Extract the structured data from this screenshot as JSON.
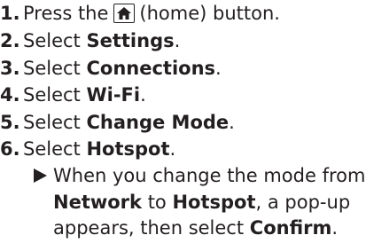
{
  "steps": [
    {
      "number": "1.",
      "before": "Press the",
      "icon": "home-icon",
      "after": "(home) button."
    },
    {
      "number": "2.",
      "text": "Select",
      "keyword": "Settings",
      "end": "."
    },
    {
      "number": "3.",
      "text": "Select",
      "keyword": "Connections",
      "end": "."
    },
    {
      "number": "4.",
      "text": "Select",
      "keyword": "Wi-Fi",
      "end": "."
    },
    {
      "number": "5.",
      "text": "Select",
      "keyword": "Change Mode",
      "end": "."
    },
    {
      "number": "6.",
      "text": "Select",
      "keyword": "Hotspot",
      "end": "."
    }
  ],
  "note": {
    "line1": "When you change the mode from",
    "line2_kw1": "Network",
    "line2_mid": "to",
    "line2_kw2": "Hotspot",
    "line2_end": ", a pop-up",
    "line3_start": "appears, then select",
    "line3_kw": "Confirm",
    "line3_end": "."
  }
}
